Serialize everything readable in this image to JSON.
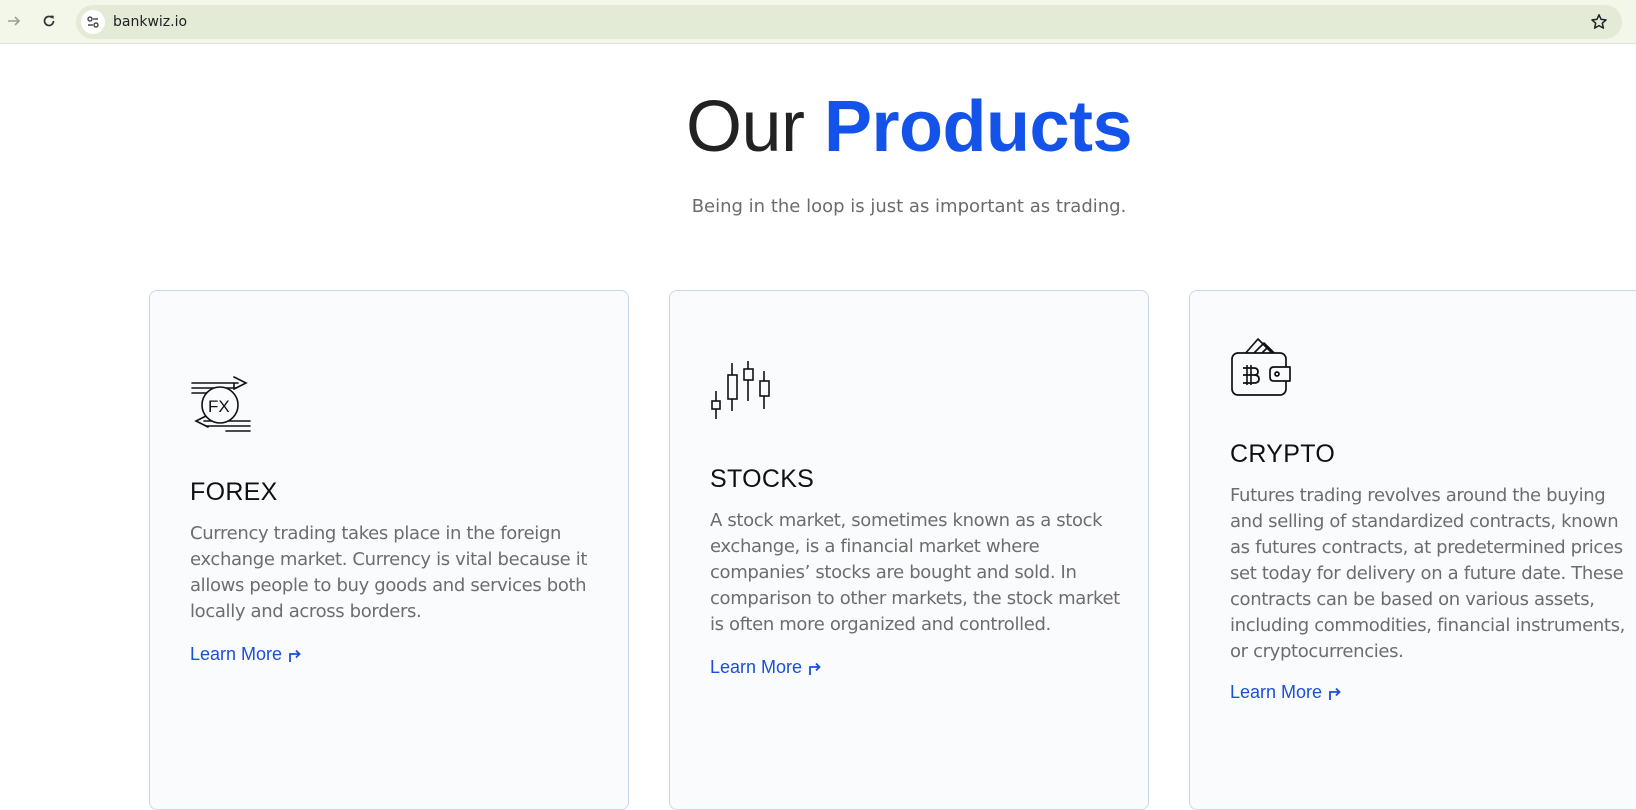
{
  "browser": {
    "url": "bankwiz.io"
  },
  "hero": {
    "title_prefix": "Our",
    "title_accent": "Products",
    "subtitle": "Being in the loop is just as important as trading."
  },
  "cards": [
    {
      "icon": "forex-exchange-icon",
      "title": "FOREX",
      "description": "Currency trading takes place in the foreign exchange market. Currency is vital because it allows people to buy goods and services both locally and across borders.",
      "link_label": "Learn More"
    },
    {
      "icon": "candlestick-chart-icon",
      "title": "STOCKS",
      "description": "A stock market, sometimes known as a stock exchange, is a financial market where companies’ stocks are bought and sold. In comparison to other markets, the stock market is often more organized and controlled.",
      "link_label": "Learn More"
    },
    {
      "icon": "bitcoin-wallet-icon",
      "title": "CRYPTO",
      "description": "Futures trading revolves around the buying and selling of standardized contracts, known as futures contracts, at predetermined prices set today for delivery on a future date. These contracts can be based on various assets, including commodities, financial instruments, or cryptocurrencies.",
      "link_label": "Learn More"
    }
  ],
  "colors": {
    "accent": "#1453ea",
    "link": "#1a4fd8",
    "card_border": "#c8d6ee",
    "chrome_bg": "#f3f7ea"
  }
}
